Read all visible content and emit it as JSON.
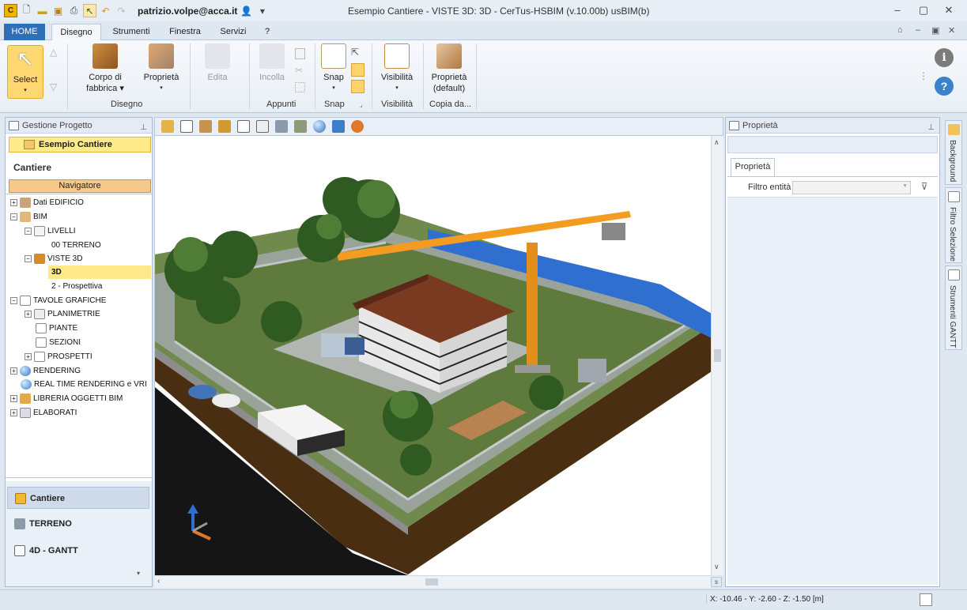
{
  "titlebar": {
    "user": "patrizio.volpe@acca.it",
    "title": "Esempio Cantiere -  VISTE 3D: 3D - CerTus-HSBIM (v.10.00b) usBIM(b)",
    "minimize_icon": "minimize-icon",
    "restore_icon": "restore-icon",
    "close_icon": "close-icon"
  },
  "tabs": {
    "home": "HOME",
    "disegno": "Disegno",
    "strumenti": "Strumenti",
    "finestra": "Finestra",
    "servizi": "Servizi",
    "help": "?"
  },
  "ribbon": {
    "select": "Select",
    "corpo_line1": "Corpo di",
    "corpo_line2": "fabbrica",
    "proprieta": "Proprietà",
    "edita": "Edita",
    "incolla": "Incolla",
    "snap": "Snap",
    "visibilita": "Visibilità",
    "prop_default_line1": "Proprietà",
    "prop_default_line2": "(default)",
    "group_disegno": "Disegno",
    "group_appunti": "Appunti",
    "group_snap": "Snap",
    "group_visibilita": "Visibilità",
    "group_copia": "Copia da..."
  },
  "leftpanel": {
    "header": "Gestione Progetto",
    "project": "Esempio Cantiere",
    "section": "Cantiere",
    "navigator": "Navigatore",
    "tree": [
      {
        "label": "Dati EDIFICIO",
        "expander": "+"
      },
      {
        "label": "BIM",
        "expander": "−"
      },
      {
        "label": "LIVELLI",
        "expander": "−"
      },
      {
        "label": "00 TERRENO",
        "expander": ""
      },
      {
        "label": "VISTE 3D",
        "expander": "−"
      },
      {
        "label": "3D",
        "expander": ""
      },
      {
        "label": "2 - Prospettiva",
        "expander": ""
      },
      {
        "label": "TAVOLE GRAFICHE",
        "expander": "−"
      },
      {
        "label": "PLANIMETRIE",
        "expander": "+"
      },
      {
        "label": "PIANTE",
        "expander": ""
      },
      {
        "label": "SEZIONI",
        "expander": ""
      },
      {
        "label": "PROSPETTI",
        "expander": "+"
      },
      {
        "label": "RENDERING",
        "expander": "+"
      },
      {
        "label": "REAL TIME RENDERING e VRI",
        "expander": ""
      },
      {
        "label": "LIBRERIA OGGETTI BIM",
        "expander": "+"
      },
      {
        "label": "ELABORATI",
        "expander": "+"
      }
    ],
    "bottom": {
      "cantiere": "Cantiere",
      "terreno": "TERRENO",
      "gantt": "4D - GANTT"
    }
  },
  "rightpanel": {
    "header": "Proprietà",
    "tab": "Proprietà",
    "filter_label": "Filtro entità",
    "filter_value": ""
  },
  "sidestrip": {
    "background": "Background",
    "filtro": "Filtro Selezione",
    "gantt": "Strumenti GANTT"
  },
  "statusbar": {
    "coords": "X: -10.46 - Y: -2.60 - Z: -1.50 [m]"
  },
  "colors": {
    "accent": "#2f6fb7",
    "selection": "#ffe98a",
    "navigator": "#f6c88a"
  }
}
